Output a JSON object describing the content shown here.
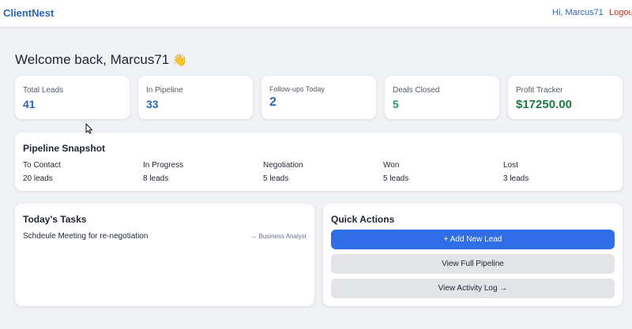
{
  "nav": {
    "brand": "ClientNest",
    "greeting": "Hi, Marcus71",
    "logout": "Logout"
  },
  "welcome": {
    "text": "Welcome back, Marcus71",
    "emoji": "👋"
  },
  "stats": [
    {
      "label": "Total Leads",
      "value": "41",
      "color": "#2a66c9"
    },
    {
      "label": "In Pipeline",
      "value": "33",
      "color": "#2a66c9"
    },
    {
      "label": "Follow-ups Today",
      "value": "2",
      "color": "#2a66c9"
    },
    {
      "label": "Deals Closed",
      "value": "5",
      "color": "#1e9e5a"
    },
    {
      "label": "Profit Tracker",
      "value": "$17250.00",
      "color": "#1e7a45"
    }
  ],
  "pipeline": {
    "title": "Pipeline Snapshot",
    "stages": [
      {
        "name": "To Contact",
        "count": "20 leads"
      },
      {
        "name": "In Progress",
        "count": "8 leads"
      },
      {
        "name": "Negotiation",
        "count": "5 leads"
      },
      {
        "name": "Won",
        "count": "5 leads"
      },
      {
        "name": "Lost",
        "count": "3 leads"
      }
    ]
  },
  "tasks": {
    "title": "Today's Tasks",
    "items": [
      {
        "name": "Schdeule Meeting for re-negotiation",
        "role": "→ Business Analyst"
      }
    ]
  },
  "quick_actions": {
    "title": "Quick Actions",
    "add_lead": "+ Add New Lead",
    "view_pipeline": "View Full Pipeline",
    "view_log": "View Activity Log →"
  }
}
